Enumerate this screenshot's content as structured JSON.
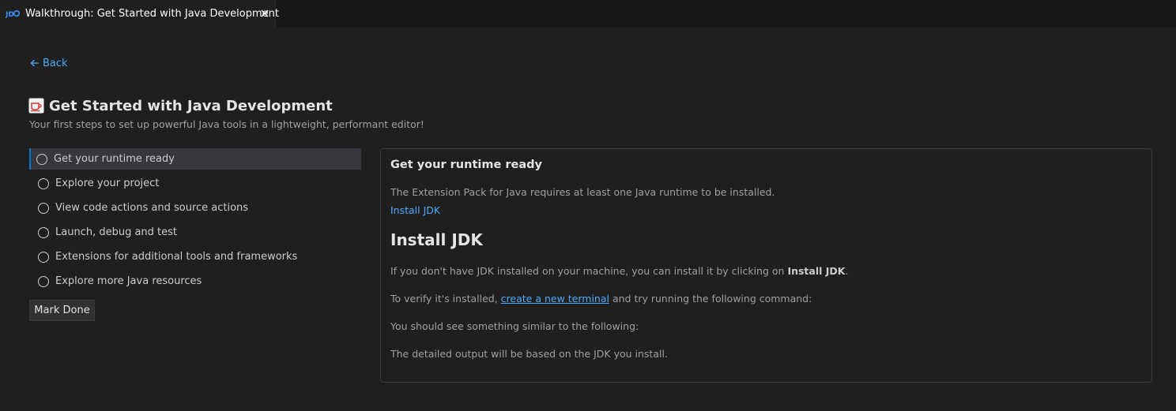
{
  "tab": {
    "icon": "java-walkthrough-icon",
    "title": "Walkthrough: Get Started with Java Development",
    "close_icon": "close-icon"
  },
  "back": {
    "icon": "arrow-left-icon",
    "label": "Back"
  },
  "walkthrough": {
    "icon": "coffee-cup-icon",
    "title": "Get Started with Java Development",
    "subtitle": "Your first steps to set up powerful Java tools in a lightweight, performant editor!"
  },
  "steps": [
    {
      "label": "Get your runtime ready",
      "active": true
    },
    {
      "label": "Explore your project",
      "active": false
    },
    {
      "label": "View code actions and source actions",
      "active": false
    },
    {
      "label": "Launch, debug and test",
      "active": false
    },
    {
      "label": "Extensions for additional tools and frameworks",
      "active": false
    },
    {
      "label": "Explore more Java resources",
      "active": false
    }
  ],
  "mark_done_label": "Mark Done",
  "detail": {
    "title": "Get your runtime ready",
    "description": "The Extension Pack for Java requires at least one Java runtime to be installed.",
    "link": "Install JDK",
    "heading": "Install JDK",
    "para1_prefix": "If you don't have JDK installed on your machine, you can install it by clicking on ",
    "para1_bold": "Install JDK",
    "para1_suffix": ".",
    "para2_prefix": "To verify it's installed, ",
    "para2_link": "create a new terminal",
    "para2_suffix": " and try running the following command:",
    "para3": "You should see something similar to the following:",
    "para4": "The detailed output will be based on the JDK you install."
  },
  "colors": {
    "accent_link": "#4daafc",
    "active_border": "#0078d4",
    "background": "#1f1f1f"
  }
}
